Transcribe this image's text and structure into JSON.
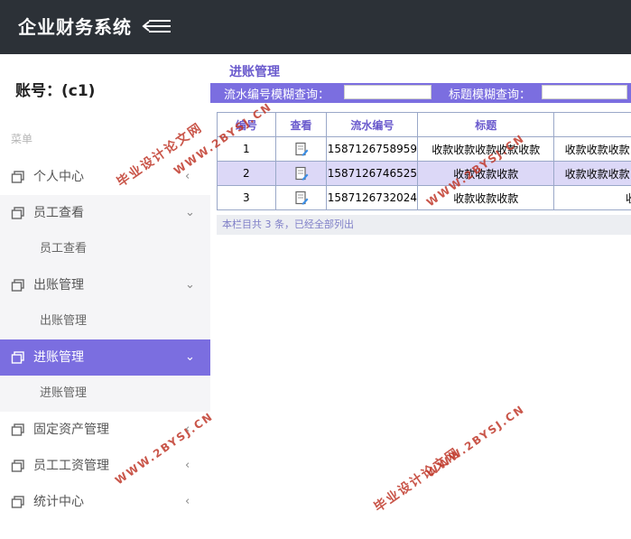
{
  "header": {
    "title": "企业财务系统"
  },
  "sidebar": {
    "account": "账号：(c1)",
    "menu_label": "菜单",
    "items": [
      {
        "label": "个人中心",
        "arrow": "‹"
      },
      {
        "label": "员工查看",
        "arrow": "⌄",
        "sub": "员工查看"
      },
      {
        "label": "出账管理",
        "arrow": "⌄",
        "sub": "出账管理"
      },
      {
        "label": "进账管理",
        "arrow": "⌄",
        "sub": "进账管理"
      },
      {
        "label": "固定资产管理",
        "arrow": "‹"
      },
      {
        "label": "员工工资管理",
        "arrow": "‹"
      },
      {
        "label": "统计中心",
        "arrow": "‹"
      }
    ]
  },
  "main": {
    "panel_title": "进账管理",
    "search": {
      "serial_label": "流水编号模糊查询：",
      "title_label": "标题模糊查询："
    },
    "columns": [
      "编号",
      "查看",
      "流水编号",
      "标题",
      ""
    ],
    "rows": [
      {
        "no": "1",
        "serial": "1587126758959",
        "title": "收款收款收款收款收款",
        "extra": "收款收款收款"
      },
      {
        "no": "2",
        "serial": "1587126746525",
        "title": "收款收款收款",
        "extra": "收款收款收款"
      },
      {
        "no": "3",
        "serial": "1587126732024",
        "title": "收款收款收款",
        "extra": "收"
      }
    ],
    "footer": "本栏目共 3 条，已经全部列出"
  },
  "watermarks": [
    "毕业设计论文网",
    "WWW.2BYSJ.CN"
  ]
}
